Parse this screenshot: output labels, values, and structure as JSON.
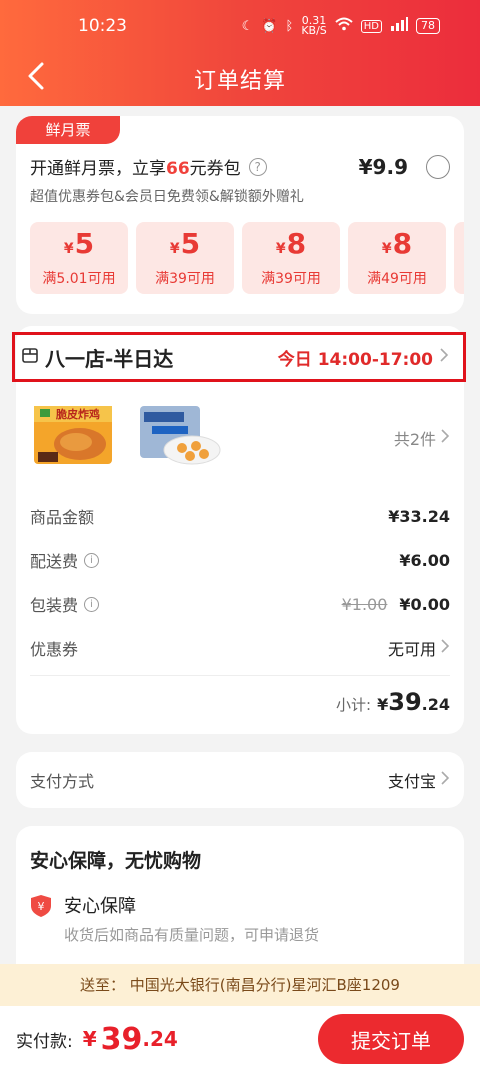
{
  "status_bar": {
    "time": "10:23",
    "net_speed": "0.31",
    "battery": "78"
  },
  "header": {
    "title": "订单结算"
  },
  "coupon_card": {
    "tag": "鲜月票",
    "headline_pre": "开通鲜月票，立享",
    "headline_num": "66",
    "headline_post": "元券包",
    "price": "¥9.9",
    "subtitle": "超值优惠券包&会员日免费领&解锁额外赠礼",
    "vouchers": [
      {
        "amount": "5",
        "cond": "满5.01可用"
      },
      {
        "amount": "5",
        "cond": "满39可用"
      },
      {
        "amount": "8",
        "cond": "满39可用"
      },
      {
        "amount": "8",
        "cond": "满49可用"
      }
    ],
    "currency": "¥"
  },
  "order": {
    "store": "八一店-半日达",
    "delivery_time": "今日 14:00-17:00",
    "item_count": "共2件",
    "rows": {
      "goods_label": "商品金额",
      "goods_value": "¥33.24",
      "delivery_label": "配送费",
      "delivery_value": "¥6.00",
      "packing_label": "包装费",
      "packing_original": "¥1.00",
      "packing_value": "¥0.00",
      "coupon_label": "优惠券",
      "coupon_value": "无可用"
    },
    "subtotal_label": "小计:",
    "subtotal_currency": "¥",
    "subtotal_int": "39",
    "subtotal_dec": ".24"
  },
  "payment": {
    "label": "支付方式",
    "value": "支付宝"
  },
  "guarantee": {
    "heading": "安心保障，无忧购物",
    "title": "安心保障",
    "desc": "收货后如商品有质量问题，可申请退货"
  },
  "address": {
    "text": "送至：  中国光大银行(南昌分行)星河汇B座1209"
  },
  "bottom": {
    "label": "实付款:",
    "currency": "¥",
    "int": "39",
    "dec": ".24",
    "submit": "提交订单"
  },
  "colors": {
    "accent": "#ec2a2f",
    "highlight_border": "#e0121b"
  }
}
